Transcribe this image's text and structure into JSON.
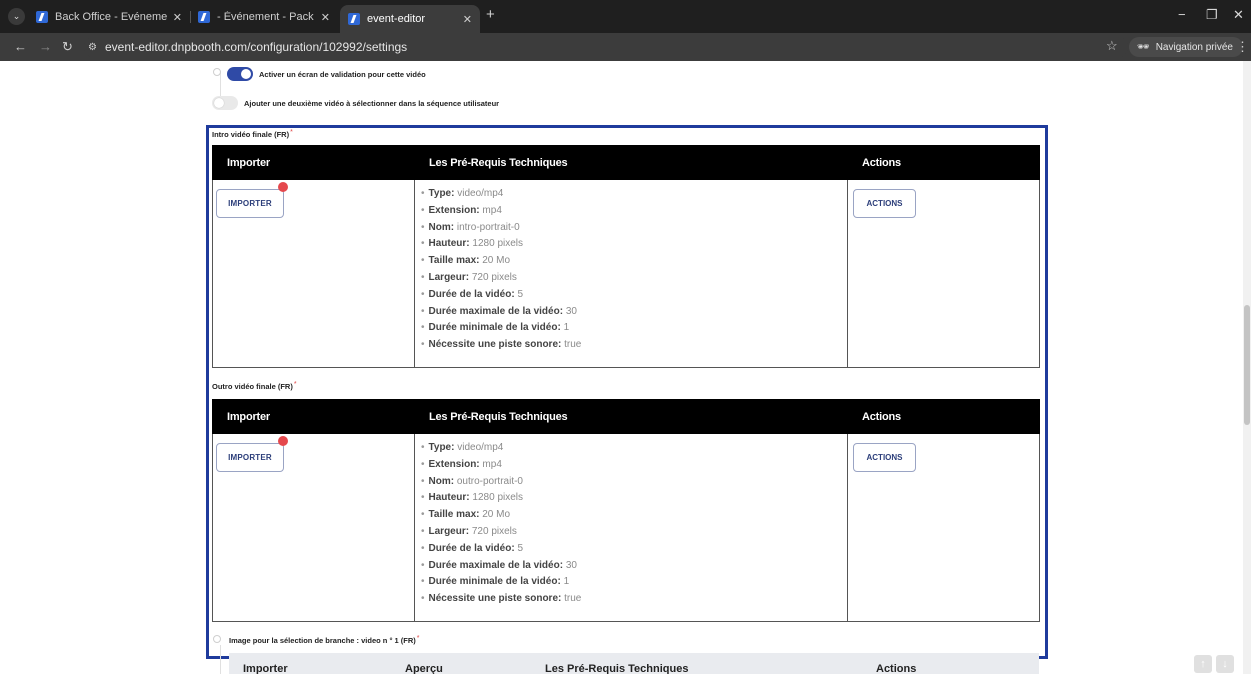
{
  "browser": {
    "tabs": [
      {
        "title": "Back Office - Evénements : Nou",
        "active": false
      },
      {
        "title": "- Événement - Pack Pro Data (D",
        "active": false
      },
      {
        "title": "event-editor",
        "active": true
      }
    ],
    "address": "event-editor.dnpbooth.com/configuration/102992/settings",
    "incognito_label": "Navigation privée"
  },
  "toggles": [
    {
      "label": "Activer un écran de validation pour cette vidéo",
      "on": true
    },
    {
      "label": "Ajouter une deuxième vidéo à sélectionner dans la séquence utilisateur",
      "on": false
    }
  ],
  "sections": [
    {
      "label": "Intro vidéo finale (FR)",
      "required_mark": "*",
      "headers": {
        "importer": "Importer",
        "requirements": "Les Pré-Requis Techniques",
        "actions": "Actions"
      },
      "import_button": "IMPORTER",
      "actions_button": "ACTIONS",
      "specs": [
        {
          "key": "Type:",
          "value": "video/mp4"
        },
        {
          "key": "Extension:",
          "value": "mp4"
        },
        {
          "key": "Nom:",
          "value": "intro-portrait-0"
        },
        {
          "key": "Hauteur:",
          "value": "1280 pixels"
        },
        {
          "key": "Taille max:",
          "value": "20 Mo"
        },
        {
          "key": "Largeur:",
          "value": "720 pixels"
        },
        {
          "key": "Durée de la vidéo:",
          "value": "5"
        },
        {
          "key": "Durée maximale de la vidéo:",
          "value": "30"
        },
        {
          "key": "Durée minimale de la vidéo:",
          "value": "1"
        },
        {
          "key": "Nécessite une piste sonore:",
          "value": "true"
        }
      ]
    },
    {
      "label": "Outro vidéo finale (FR)",
      "required_mark": "*",
      "headers": {
        "importer": "Importer",
        "requirements": "Les Pré-Requis Techniques",
        "actions": "Actions"
      },
      "import_button": "IMPORTER",
      "actions_button": "ACTIONS",
      "specs": [
        {
          "key": "Type:",
          "value": "video/mp4"
        },
        {
          "key": "Extension:",
          "value": "mp4"
        },
        {
          "key": "Nom:",
          "value": "outro-portrait-0"
        },
        {
          "key": "Hauteur:",
          "value": "1280 pixels"
        },
        {
          "key": "Taille max:",
          "value": "20 Mo"
        },
        {
          "key": "Largeur:",
          "value": "720 pixels"
        },
        {
          "key": "Durée de la vidéo:",
          "value": "5"
        },
        {
          "key": "Durée maximale de la vidéo:",
          "value": "30"
        },
        {
          "key": "Durée minimale de la vidéo:",
          "value": "1"
        },
        {
          "key": "Nécessite une piste sonore:",
          "value": "true"
        }
      ]
    }
  ],
  "branch": {
    "label": "Image pour la sélection de branche : video n ° 1 (FR)",
    "required_mark": "*",
    "headers": {
      "importer": "Importer",
      "preview": "Aperçu",
      "requirements": "Les Pré-Requis Techniques",
      "actions": "Actions"
    }
  },
  "colors": {
    "frame": "#1f3b9c",
    "toggle_on": "#2f4aa6",
    "badge": "#e5484d",
    "header_bg": "#000000"
  }
}
